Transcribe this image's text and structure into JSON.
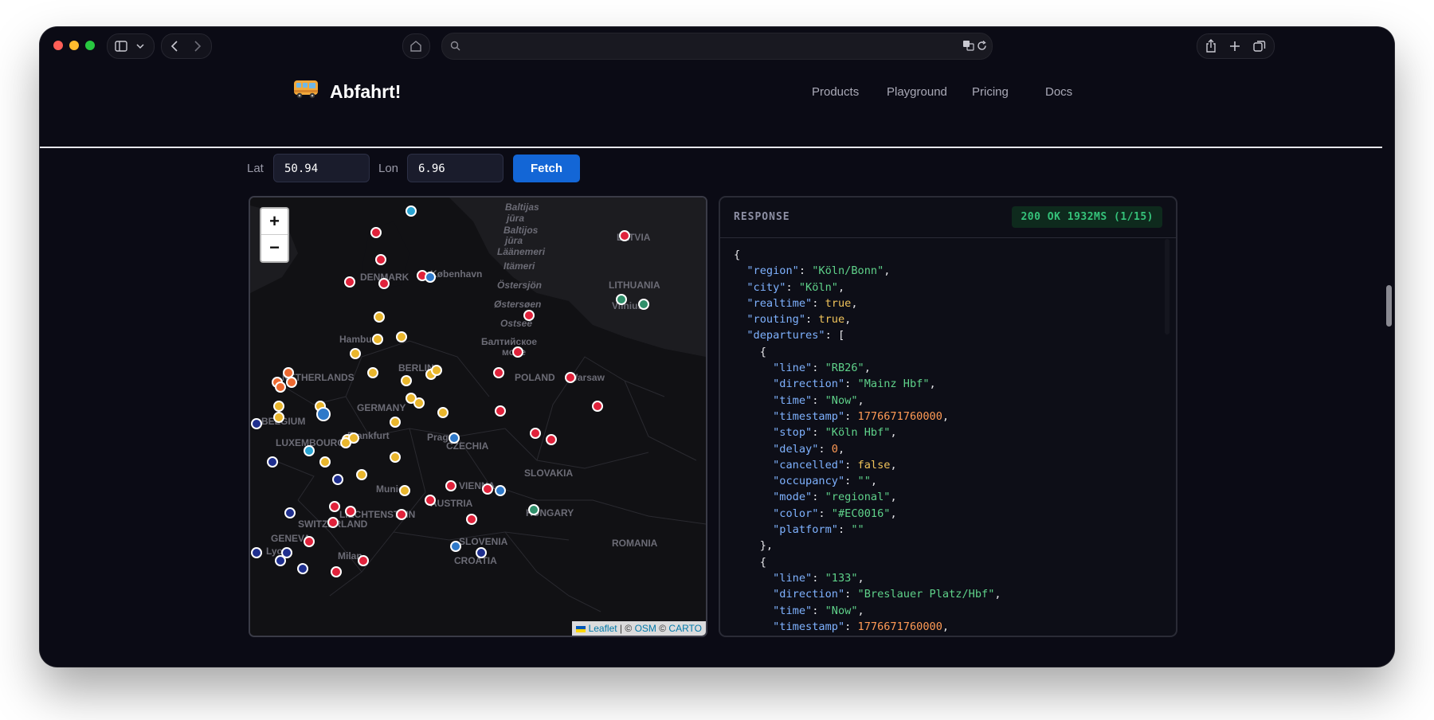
{
  "site": {
    "brand": "Abfahrt!",
    "nav": [
      "Products",
      "Playground",
      "Pricing",
      "Docs"
    ]
  },
  "form": {
    "lat_label": "Lat",
    "lat_value": "50.94",
    "lon_label": "Lon",
    "lon_value": "6.96",
    "fetch_label": "Fetch"
  },
  "map": {
    "zoom_in": "+",
    "zoom_out": "−",
    "attribution": {
      "leaflet": "Leaflet",
      "sep1": " | © ",
      "osm": "OSM",
      "sep2": " © ",
      "carto": "CARTO"
    },
    "place_labels": [
      "Baltijas",
      "jūra",
      "Baltijos",
      "jūra",
      "Läänemeri",
      "Itämeri",
      "Östersjön",
      "Østersøen",
      "Ostsee",
      "Балтийское",
      "море",
      "DENMARK",
      "København",
      "LITHUANIA",
      "Vilnius",
      "Hamburg",
      "BERLIN",
      "NETHERLANDS",
      "POLAND",
      "Warsaw",
      "BELGIUM",
      "GERMANY",
      "LUXEMBOURG",
      "Frankfurt",
      "Prague",
      "CZECHIA",
      "SLOVAKIA",
      "Munich",
      "VIENNA",
      "AUSTRIA",
      "HUNGARY",
      "LIECHTENSTEIN",
      "SWITZERLAND",
      "GENEVA",
      "SLOVENIA",
      "CROATIA",
      "ROMANIA",
      "Milan",
      "Lyon",
      "LATVIA"
    ],
    "marker_colors": {
      "red": "#e0223b",
      "yellow": "#e9b62d",
      "orange": "#ee6a31",
      "blue": "#2f79c9",
      "navy": "#1f2f8f",
      "green": "#2f8f6a",
      "cyan": "#2aa4d2"
    }
  },
  "response": {
    "title": "RESPONSE",
    "status": "200 OK 1932MS (1/15)",
    "json_lines": [
      [
        [
          "p",
          "{"
        ]
      ],
      [
        [
          "p",
          "  "
        ],
        [
          "k",
          "\"region\""
        ],
        [
          "p",
          ": "
        ],
        [
          "s",
          "\"Köln/Bonn\""
        ],
        [
          "p",
          ","
        ]
      ],
      [
        [
          "p",
          "  "
        ],
        [
          "k",
          "\"city\""
        ],
        [
          "p",
          ": "
        ],
        [
          "s",
          "\"Köln\""
        ],
        [
          "p",
          ","
        ]
      ],
      [
        [
          "p",
          "  "
        ],
        [
          "k",
          "\"realtime\""
        ],
        [
          "p",
          ": "
        ],
        [
          "b",
          "true"
        ],
        [
          "p",
          ","
        ]
      ],
      [
        [
          "p",
          "  "
        ],
        [
          "k",
          "\"routing\""
        ],
        [
          "p",
          ": "
        ],
        [
          "b",
          "true"
        ],
        [
          "p",
          ","
        ]
      ],
      [
        [
          "p",
          "  "
        ],
        [
          "k",
          "\"departures\""
        ],
        [
          "p",
          ": ["
        ]
      ],
      [
        [
          "p",
          "    {"
        ]
      ],
      [
        [
          "p",
          "      "
        ],
        [
          "k",
          "\"line\""
        ],
        [
          "p",
          ": "
        ],
        [
          "s",
          "\"RB26\""
        ],
        [
          "p",
          ","
        ]
      ],
      [
        [
          "p",
          "      "
        ],
        [
          "k",
          "\"direction\""
        ],
        [
          "p",
          ": "
        ],
        [
          "s",
          "\"Mainz Hbf\""
        ],
        [
          "p",
          ","
        ]
      ],
      [
        [
          "p",
          "      "
        ],
        [
          "k",
          "\"time\""
        ],
        [
          "p",
          ": "
        ],
        [
          "s",
          "\"Now\""
        ],
        [
          "p",
          ","
        ]
      ],
      [
        [
          "p",
          "      "
        ],
        [
          "k",
          "\"timestamp\""
        ],
        [
          "p",
          ": "
        ],
        [
          "n",
          "1776671760000"
        ],
        [
          "p",
          ","
        ]
      ],
      [
        [
          "p",
          "      "
        ],
        [
          "k",
          "\"stop\""
        ],
        [
          "p",
          ": "
        ],
        [
          "s",
          "\"Köln Hbf\""
        ],
        [
          "p",
          ","
        ]
      ],
      [
        [
          "p",
          "      "
        ],
        [
          "k",
          "\"delay\""
        ],
        [
          "p",
          ": "
        ],
        [
          "n",
          "0"
        ],
        [
          "p",
          ","
        ]
      ],
      [
        [
          "p",
          "      "
        ],
        [
          "k",
          "\"cancelled\""
        ],
        [
          "p",
          ": "
        ],
        [
          "b",
          "false"
        ],
        [
          "p",
          ","
        ]
      ],
      [
        [
          "p",
          "      "
        ],
        [
          "k",
          "\"occupancy\""
        ],
        [
          "p",
          ": "
        ],
        [
          "s",
          "\"\""
        ],
        [
          "p",
          ","
        ]
      ],
      [
        [
          "p",
          "      "
        ],
        [
          "k",
          "\"mode\""
        ],
        [
          "p",
          ": "
        ],
        [
          "s",
          "\"regional\""
        ],
        [
          "p",
          ","
        ]
      ],
      [
        [
          "p",
          "      "
        ],
        [
          "k",
          "\"color\""
        ],
        [
          "p",
          ": "
        ],
        [
          "s",
          "\"#EC0016\""
        ],
        [
          "p",
          ","
        ]
      ],
      [
        [
          "p",
          "      "
        ],
        [
          "k",
          "\"platform\""
        ],
        [
          "p",
          ": "
        ],
        [
          "s",
          "\"\""
        ]
      ],
      [
        [
          "p",
          "    },"
        ]
      ],
      [
        [
          "p",
          "    {"
        ]
      ],
      [
        [
          "p",
          "      "
        ],
        [
          "k",
          "\"line\""
        ],
        [
          "p",
          ": "
        ],
        [
          "s",
          "\"133\""
        ],
        [
          "p",
          ","
        ]
      ],
      [
        [
          "p",
          "      "
        ],
        [
          "k",
          "\"direction\""
        ],
        [
          "p",
          ": "
        ],
        [
          "s",
          "\"Breslauer Platz/Hbf\""
        ],
        [
          "p",
          ","
        ]
      ],
      [
        [
          "p",
          "      "
        ],
        [
          "k",
          "\"time\""
        ],
        [
          "p",
          ": "
        ],
        [
          "s",
          "\"Now\""
        ],
        [
          "p",
          ","
        ]
      ],
      [
        [
          "p",
          "      "
        ],
        [
          "k",
          "\"timestamp\""
        ],
        [
          "p",
          ": "
        ],
        [
          "n",
          "1776671760000"
        ],
        [
          "p",
          ","
        ]
      ]
    ]
  }
}
